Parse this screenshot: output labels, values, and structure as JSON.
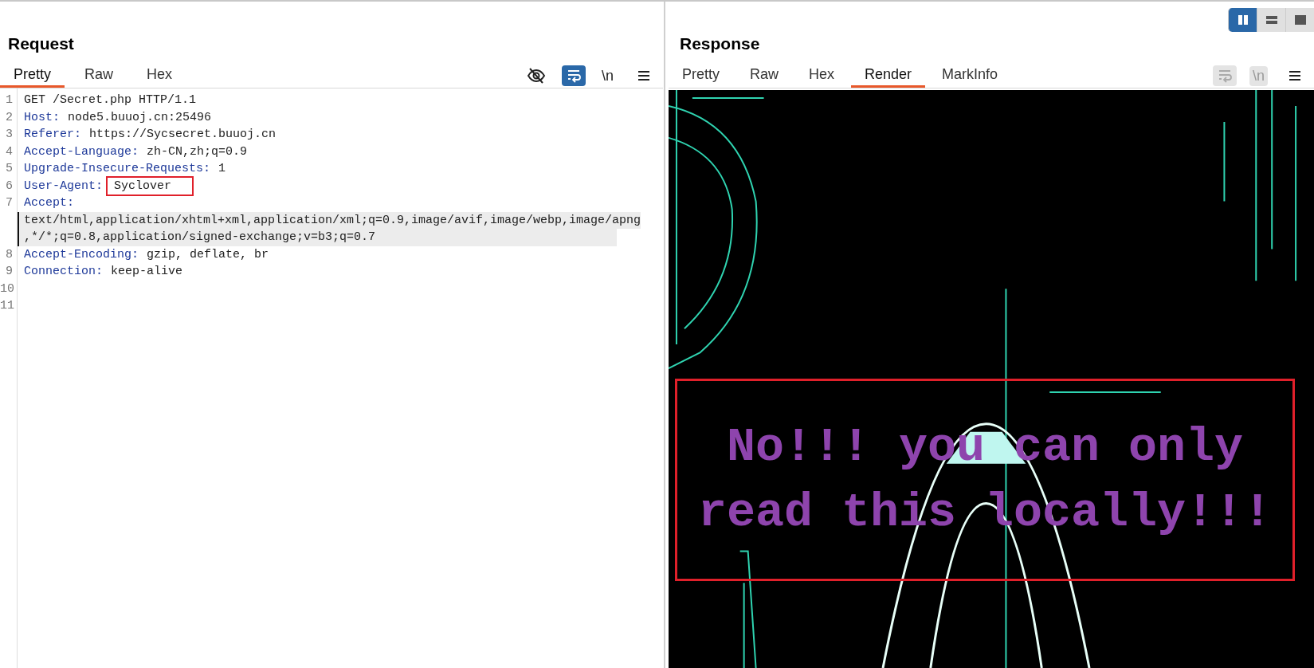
{
  "request": {
    "title": "Request",
    "tabs": [
      {
        "label": "Pretty",
        "selected": true
      },
      {
        "label": "Raw",
        "selected": false
      },
      {
        "label": "Hex",
        "selected": false
      }
    ],
    "toolbar": {
      "wrap_on": true,
      "newline_label": "\\n",
      "disabled": false
    },
    "lines": [
      {
        "kind": "request-line",
        "number": "1",
        "value": "GET /Secret.php HTTP/1.1",
        "boxed": false
      },
      {
        "kind": "header",
        "number": "2",
        "name": "Host:",
        "value": "node5.buuoj.cn:25496",
        "boxed": false
      },
      {
        "kind": "header",
        "number": "3",
        "name": "Referer:",
        "value": "https://Sycsecret.buuoj.cn",
        "boxed": false
      },
      {
        "kind": "header",
        "number": "4",
        "name": "Accept-Language:",
        "value": "zh-CN,zh;q=0.9",
        "boxed": false
      },
      {
        "kind": "header",
        "number": "5",
        "name": "Upgrade-Insecure-Requests:",
        "value": "1",
        "boxed": false
      },
      {
        "kind": "header",
        "number": "6",
        "name": "User-Agent:",
        "value": "Syclover",
        "boxed": true
      },
      {
        "kind": "header",
        "number": "7",
        "name": "Accept:",
        "boxed": false
      },
      {
        "kind": "wrap",
        "value": "text/html,application/xhtml+xml,application/xml;q=0.9,image/avif,image/webp,image/apng",
        "current": true
      },
      {
        "kind": "wrap",
        "value": ",*/*;q=0.8,application/signed-exchange;v=b3;q=0.7",
        "current": true
      },
      {
        "kind": "header",
        "number": "8",
        "name": "Accept-Encoding:",
        "value": "gzip, deflate, br",
        "boxed": false
      },
      {
        "kind": "header",
        "number": "9",
        "name": "Connection:",
        "value": "keep-alive",
        "boxed": false
      },
      {
        "kind": "blank",
        "number": "10"
      },
      {
        "kind": "blank",
        "number": "11"
      }
    ]
  },
  "response": {
    "title": "Response",
    "tabs": [
      {
        "label": "Pretty",
        "selected": false
      },
      {
        "label": "Raw",
        "selected": false
      },
      {
        "label": "Hex",
        "selected": false
      },
      {
        "label": "Render",
        "selected": true
      },
      {
        "label": "MarkInfo",
        "selected": false
      }
    ],
    "toolbar": {
      "wrap_on": false,
      "newline_label": "\\n",
      "disabled": true
    },
    "render": {
      "message_lines": [
        "No!!! you can only",
        "read this locally!!!"
      ],
      "boxed": true
    }
  },
  "layout_toggle": [
    {
      "kind": "side-by-side",
      "selected": true
    },
    {
      "kind": "stacked",
      "selected": false
    },
    {
      "kind": "single",
      "selected": false
    }
  ]
}
